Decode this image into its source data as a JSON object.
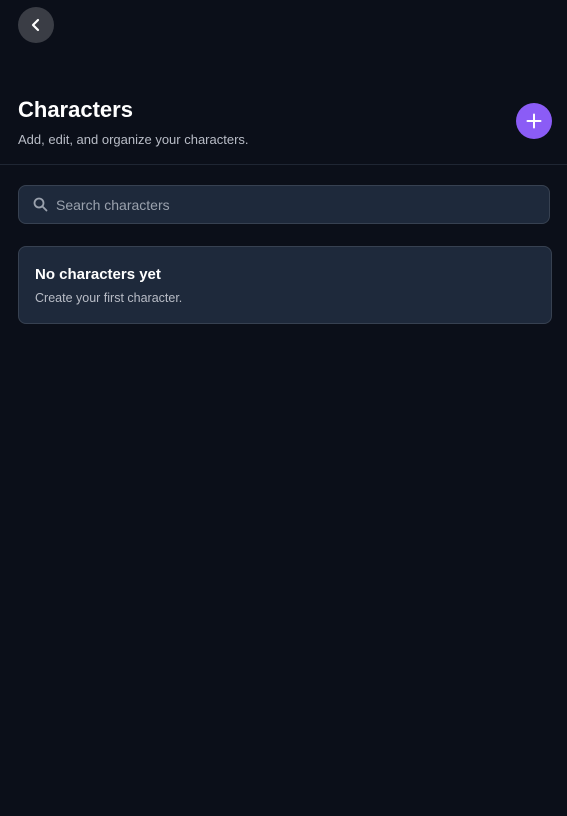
{
  "nav": {
    "back_icon": "chevron-left-icon"
  },
  "header": {
    "title": "Characters",
    "subtitle": "Add, edit, and organize your characters.",
    "add_icon": "plus-icon"
  },
  "search": {
    "placeholder": "Search characters",
    "value": "",
    "icon": "search-icon"
  },
  "empty_state": {
    "title": "No characters yet",
    "description": "Create your first character."
  },
  "colors": {
    "background": "#0b0f19",
    "accent": "#8b5cf6",
    "card": "#1e293b",
    "back_button": "#3a3d45"
  }
}
